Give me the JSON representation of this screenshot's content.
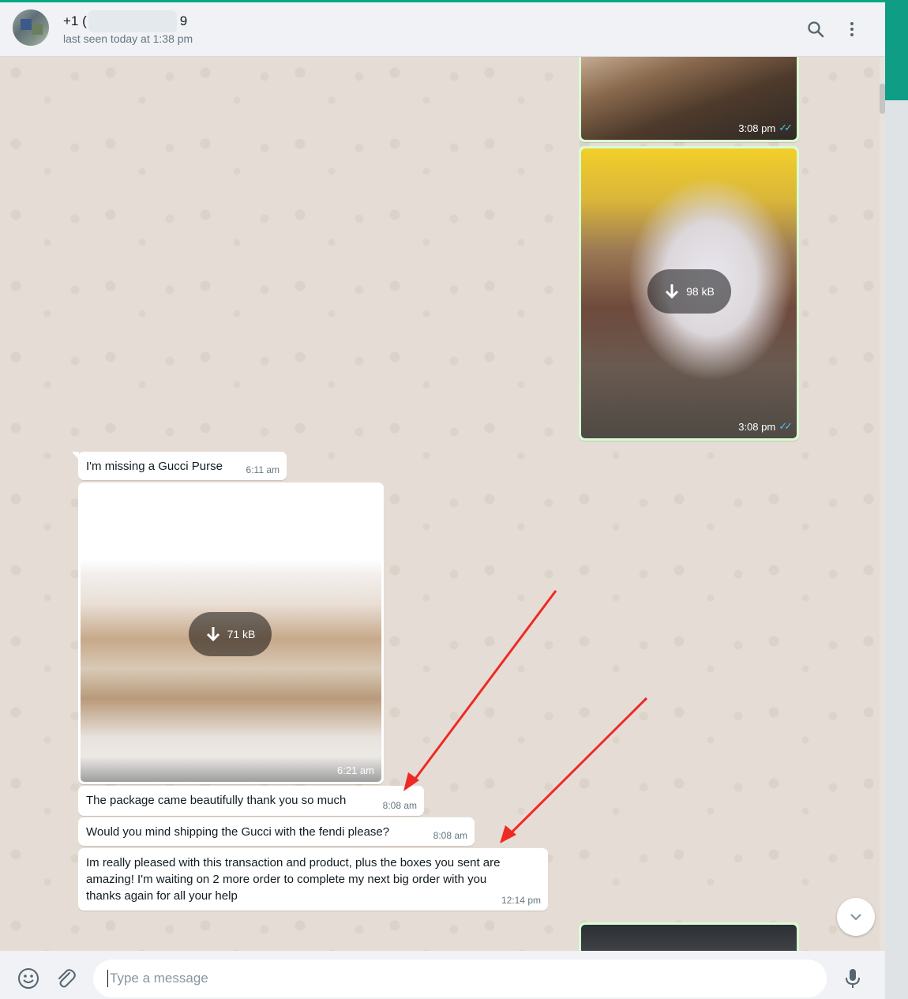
{
  "header": {
    "contact_name": "+1 (",
    "contact_name_end": "9",
    "last_seen": "last seen today at 1:38 pm",
    "icons": [
      "search-icon",
      "menu-icon"
    ]
  },
  "messages": {
    "outgoing_image_1": {
      "time": "3:08 pm",
      "status": "read"
    },
    "outgoing_image_2": {
      "time": "3:08 pm",
      "download_size": "98 kB",
      "status": "read"
    },
    "incoming_text_1": {
      "text": "I'm missing a Gucci Purse",
      "time": "6:11 am"
    },
    "incoming_image_1": {
      "time": "6:21 am",
      "download_size": "71 kB"
    },
    "incoming_text_2": {
      "text": "The package came beautifully thank you so much",
      "time": "8:08 am"
    },
    "incoming_text_3": {
      "text": "Would you mind shipping the Gucci with the fendi please?",
      "time": "8:08 am"
    },
    "incoming_text_4": {
      "line1": "Im really pleased with this transaction and product, plus the boxes you sent are",
      "line2": "amazing! I'm waiting on 2 more order to complete my next big order with you",
      "line3": "thanks again for all your help",
      "time": "12:14 pm"
    }
  },
  "footer": {
    "placeholder": "Type a message",
    "icons": [
      "emoji-icon",
      "attach-icon",
      "microphone-icon"
    ]
  },
  "colors": {
    "accent": "#00a884",
    "outgoing_bubble": "#d9fdd3",
    "incoming_bubble": "#ffffff",
    "annotation_arrow": "#ee2a24",
    "read_ticks": "#53bdeb"
  }
}
